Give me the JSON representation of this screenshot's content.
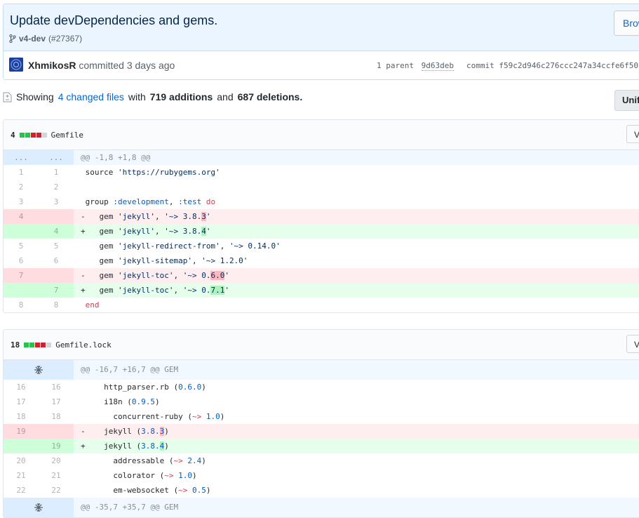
{
  "commit": {
    "title": "Update devDependencies and gems.",
    "branch": "v4-dev",
    "pr": "(#27367)",
    "browse_label": "Brow",
    "author": "XhmikosR",
    "action": "committed 3 days ago",
    "parent_label": "1 parent",
    "parent_sha": "9d63deb",
    "commit_label": "commit",
    "commit_sha": "f59c2d946c276ccc247a34ccfe6f50"
  },
  "summary": {
    "showing": "Showing",
    "files_link": "4 changed files",
    "with": "with",
    "additions": "719 additions",
    "and": "and",
    "deletions": "687 deletions.",
    "unified_label": "Unif"
  },
  "files": [
    {
      "count": "4",
      "name": "Gemfile",
      "view_label": "V",
      "hunk_ln": "...",
      "hunk": "@@ -1,8 +1,8 @@"
    },
    {
      "count": "18",
      "name": "Gemfile.lock",
      "view_label": "V",
      "hunk1": "@@ -16,7 +16,7 @@ GEM",
      "hunk2": "@@ -35,7 +35,7 @@ GEM"
    }
  ],
  "colors": {
    "accent": "#0366d6",
    "add": "#2cbe4e",
    "del": "#cb2431"
  },
  "icons": [
    "branch-icon",
    "file-diff-icon",
    "expand-icon"
  ]
}
